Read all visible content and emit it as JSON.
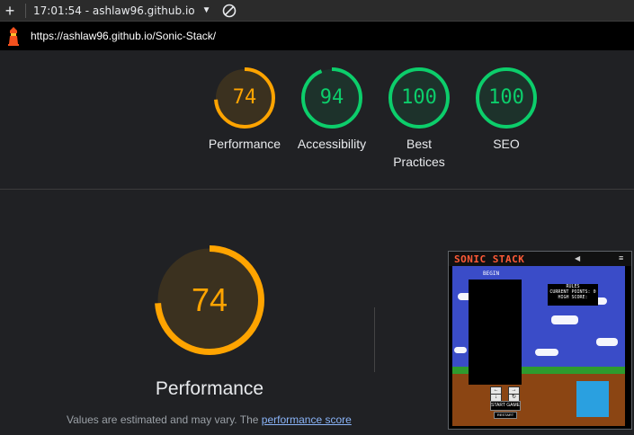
{
  "toolbar": {
    "new_tab_icon": "plus-icon",
    "title": "17:01:54 - ashlaw96.github.io",
    "dropdown_icon": "caret-down-icon",
    "block_icon": "prohibited-icon"
  },
  "urlbar": {
    "logo_icon": "lighthouse-icon",
    "url": "https://ashlaw96.github.io/Sonic-Stack/"
  },
  "scores": [
    {
      "label": "Performance",
      "value": "74",
      "color": "#ffa400",
      "fraction": 0.74
    },
    {
      "label": "Accessibility",
      "value": "94",
      "color": "#0cce6b",
      "fraction": 0.94
    },
    {
      "label": "Best Practices",
      "value": "100",
      "color": "#0cce6b",
      "fraction": 1.0
    },
    {
      "label": "SEO",
      "value": "100",
      "color": "#0cce6b",
      "fraction": 1.0
    }
  ],
  "best_practices_lines": [
    "Best",
    "Practices"
  ],
  "main_gauge": {
    "value": "74",
    "label": "Performance",
    "color": "#ffa400",
    "fraction": 0.74
  },
  "note": {
    "text": "Values are estimated and may vary. The ",
    "link": "performance score"
  },
  "thumbnail": {
    "title": "SONIC STACK",
    "grid_header": "BEGIN",
    "info_lines": [
      "RULES",
      "CURRENT POINTS: 0",
      "HIGH SCORE:"
    ],
    "start_label": "START GAME",
    "restart_label": "RESTART"
  }
}
